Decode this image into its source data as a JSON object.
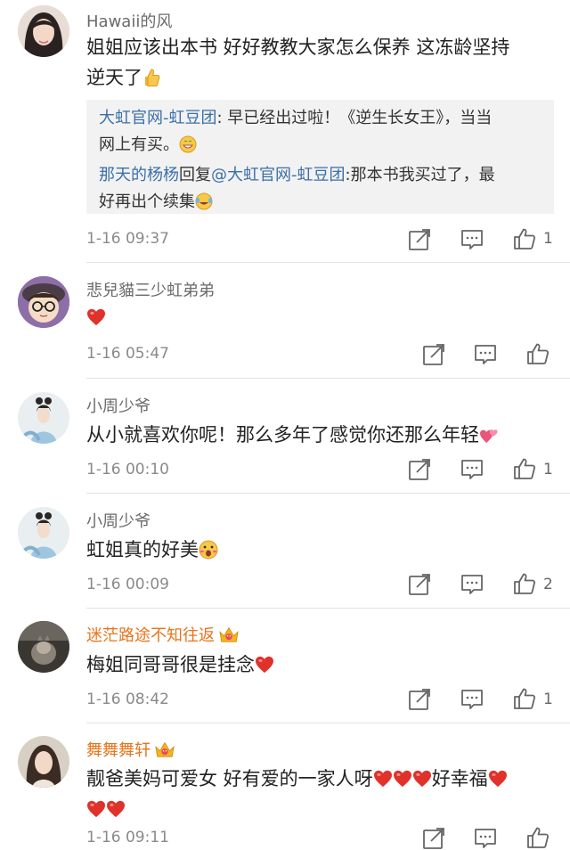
{
  "comments": [
    {
      "username": "Hawaii的风",
      "text": "姐姐应该出本书 好好教教大家怎么保养 这冻龄坚持逆天了",
      "text_line1": "姐姐应该出本书 好好教教大家怎么保养 这冻龄坚持",
      "text_line2": "逆天了",
      "replies": [
        {
          "author": "大虹官网-虹豆团",
          "text": ": 早已经出过啦！《逆生长女王》，当当",
          "text2": "网上有买。"
        },
        {
          "author": "那天的杨杨",
          "mid": "回复",
          "mention": "@大虹官网-虹豆团",
          "text": ":那本书我买过了，最",
          "text2": "好再出个续集"
        }
      ],
      "time": "1-16 09:37",
      "likes": "1"
    },
    {
      "username": "悲兒貓三少虹弟弟",
      "text": "",
      "time": "1-16 05:47",
      "likes": ""
    },
    {
      "username": "小周少爷",
      "text": "从小就喜欢你呢！那么多年了感觉你还那么年轻",
      "time": "1-16 00:10",
      "likes": "1"
    },
    {
      "username": "小周少爷",
      "text": "虹姐真的好美",
      "time": "1-16 00:09",
      "likes": "2"
    },
    {
      "username": "迷茫路途不知往返",
      "text": "梅姐同哥哥很是挂念",
      "time": "1-16 08:42",
      "likes": "1"
    },
    {
      "username": "舞舞舞轩",
      "text_part1": "靓爸美妈可爱女 好有爱的一家人呀",
      "text_part2": "好幸福",
      "time": "1-16 09:11",
      "likes": ""
    }
  ],
  "colors": {
    "accent_orange": "#e8741c",
    "link_blue": "#3b6fa8",
    "heart_red": "#e0312b",
    "meta_gray": "#8a8a8a"
  },
  "icons": {
    "share": "share-icon",
    "reply": "comment-icon",
    "like": "thumbs-up-icon"
  }
}
